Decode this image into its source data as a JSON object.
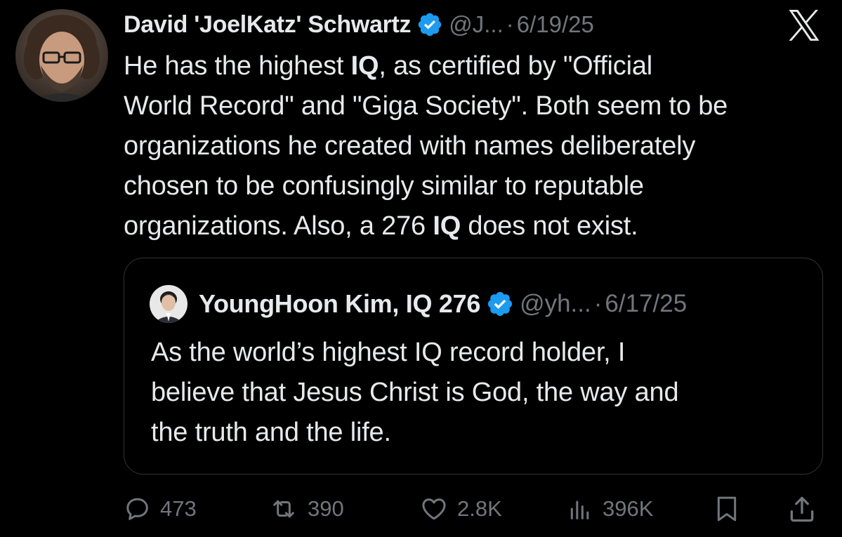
{
  "tweet": {
    "author": {
      "display_name": "David 'JoelKatz' Schwartz",
      "handle": "@J...",
      "verified": true
    },
    "separator": "·",
    "date": "6/19/25",
    "text_segments": [
      {
        "text": "He has the highest ",
        "bold": false
      },
      {
        "text": "IQ",
        "bold": true
      },
      {
        "text": ", as certified by \"Official\nWorld Record\" and \"Giga Society\". Both seem to be\norganizations he created with names deliberately\nchosen to be confusingly similar to reputable\norganizations. Also, a 276 ",
        "bold": false
      },
      {
        "text": "IQ",
        "bold": true
      },
      {
        "text": " does not exist.",
        "bold": false
      }
    ]
  },
  "quoted_tweet": {
    "author": {
      "display_name": "YoungHoon Kim, IQ 276",
      "handle": "@yh...",
      "verified": true
    },
    "separator": "·",
    "date": "6/17/25",
    "text": "As the world’s highest IQ record holder, I\nbelieve that Jesus Christ is God, the way and\nthe truth and the life."
  },
  "actions": {
    "replies": {
      "icon": "reply-icon",
      "count": "473"
    },
    "retweets": {
      "icon": "retweet-icon",
      "count": "390"
    },
    "likes": {
      "icon": "like-icon",
      "count": "2.8K"
    },
    "views": {
      "icon": "views-icon",
      "count": "396K"
    },
    "bookmark": {
      "icon": "bookmark-icon"
    },
    "share": {
      "icon": "share-icon"
    }
  },
  "colors": {
    "background": "#000000",
    "text_primary": "#e7e9ea",
    "text_secondary": "#71767b",
    "verified_blue": "#1d9bf0",
    "card_border": "#2f3336"
  }
}
